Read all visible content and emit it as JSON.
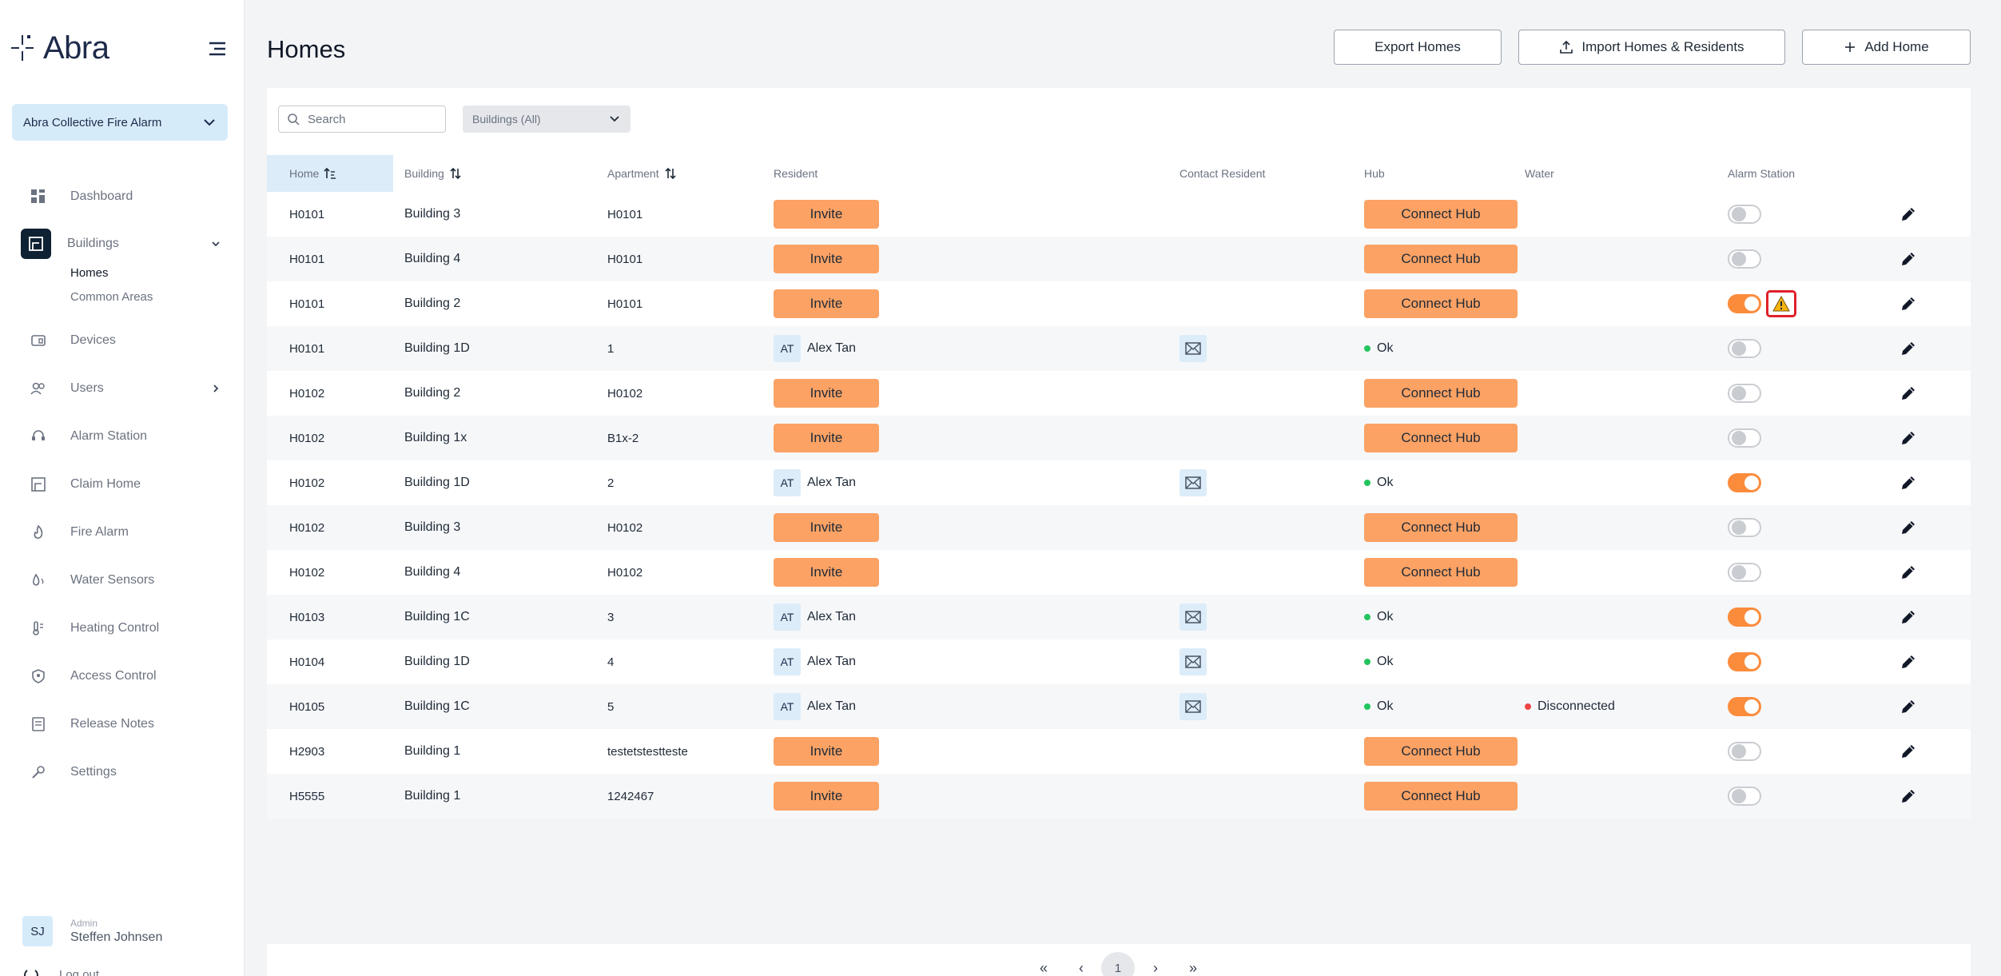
{
  "app": {
    "logo_text": "Abra"
  },
  "sidebar": {
    "org_select": "Abra Collective Fire Alarm",
    "items": [
      {
        "label": "Dashboard",
        "icon": "dashboard-icon"
      },
      {
        "label": "Buildings",
        "icon": "building-icon"
      },
      {
        "label": "Devices",
        "icon": "devices-icon"
      },
      {
        "label": "Users",
        "icon": "users-icon"
      },
      {
        "label": "Alarm Station",
        "icon": "headset-icon"
      },
      {
        "label": "Claim Home",
        "icon": "home-icon"
      },
      {
        "label": "Fire Alarm",
        "icon": "fire-icon"
      },
      {
        "label": "Water Sensors",
        "icon": "water-icon"
      },
      {
        "label": "Heating Control",
        "icon": "thermometer-icon"
      },
      {
        "label": "Access Control",
        "icon": "shield-icon"
      },
      {
        "label": "Release Notes",
        "icon": "notes-icon"
      },
      {
        "label": "Settings",
        "icon": "wrench-icon"
      }
    ],
    "sub_items": [
      "Homes",
      "Common Areas"
    ],
    "user": {
      "initials": "SJ",
      "role": "Admin",
      "name": "Steffen Johnsen"
    },
    "logout": "Log out"
  },
  "header": {
    "title": "Homes",
    "export_label": "Export Homes",
    "import_label": "Import Homes & Residents",
    "add_label": "Add Home"
  },
  "filters": {
    "search_placeholder": "Search",
    "buildings_select": "Buildings (All)"
  },
  "table": {
    "columns": [
      "Home",
      "Building",
      "Apartment",
      "Resident",
      "Contact Resident",
      "Hub",
      "Water",
      "Alarm Station"
    ],
    "invite_label": "Invite",
    "connect_label": "Connect Hub",
    "rows": [
      {
        "home": "H0101",
        "building": "Building 3",
        "apartment": "H0101",
        "resident": null,
        "hub": null,
        "water": null,
        "alarm": false,
        "warning": false
      },
      {
        "home": "H0101",
        "building": "Building 4",
        "apartment": "H0101",
        "resident": null,
        "hub": null,
        "water": null,
        "alarm": false,
        "warning": false
      },
      {
        "home": "H0101",
        "building": "Building 2",
        "apartment": "H0101",
        "resident": null,
        "hub": null,
        "water": null,
        "alarm": true,
        "warning": true
      },
      {
        "home": "H0101",
        "building": "Building 1D",
        "apartment": "1",
        "resident": {
          "initials": "AT",
          "name": "Alex Tan"
        },
        "hub": "Ok",
        "water": null,
        "alarm": false,
        "warning": false
      },
      {
        "home": "H0102",
        "building": "Building 2",
        "apartment": "H0102",
        "resident": null,
        "hub": null,
        "water": null,
        "alarm": false,
        "warning": false
      },
      {
        "home": "H0102",
        "building": "Building 1x",
        "apartment": "B1x-2",
        "resident": null,
        "hub": null,
        "water": null,
        "alarm": false,
        "warning": false
      },
      {
        "home": "H0102",
        "building": "Building 1D",
        "apartment": "2",
        "resident": {
          "initials": "AT",
          "name": "Alex Tan"
        },
        "hub": "Ok",
        "water": null,
        "alarm": true,
        "warning": false
      },
      {
        "home": "H0102",
        "building": "Building 3",
        "apartment": "H0102",
        "resident": null,
        "hub": null,
        "water": null,
        "alarm": false,
        "warning": false
      },
      {
        "home": "H0102",
        "building": "Building 4",
        "apartment": "H0102",
        "resident": null,
        "hub": null,
        "water": null,
        "alarm": false,
        "warning": false
      },
      {
        "home": "H0103",
        "building": "Building 1C",
        "apartment": "3",
        "resident": {
          "initials": "AT",
          "name": "Alex Tan"
        },
        "hub": "Ok",
        "water": null,
        "alarm": true,
        "warning": false
      },
      {
        "home": "H0104",
        "building": "Building 1D",
        "apartment": "4",
        "resident": {
          "initials": "AT",
          "name": "Alex Tan"
        },
        "hub": "Ok",
        "water": null,
        "alarm": true,
        "warning": false
      },
      {
        "home": "H0105",
        "building": "Building 1C",
        "apartment": "5",
        "resident": {
          "initials": "AT",
          "name": "Alex Tan"
        },
        "hub": "Ok",
        "water": "Disconnected",
        "alarm": true,
        "warning": false
      },
      {
        "home": "H2903",
        "building": "Building 1",
        "apartment": "testetstesttestе",
        "resident": null,
        "hub": null,
        "water": null,
        "alarm": false,
        "warning": false
      },
      {
        "home": "H5555",
        "building": "Building 1",
        "apartment": "1242467",
        "resident": null,
        "hub": null,
        "water": null,
        "alarm": false,
        "warning": false
      }
    ]
  },
  "pagination": {
    "first": "«",
    "prev": "‹",
    "current": "1",
    "next": "›",
    "last": "»"
  },
  "colors": {
    "accent": "#fba264",
    "toggle_on": "#fb8c3c",
    "ok": "#22c55e",
    "error": "#ef4444",
    "warning": "#e0202a"
  }
}
